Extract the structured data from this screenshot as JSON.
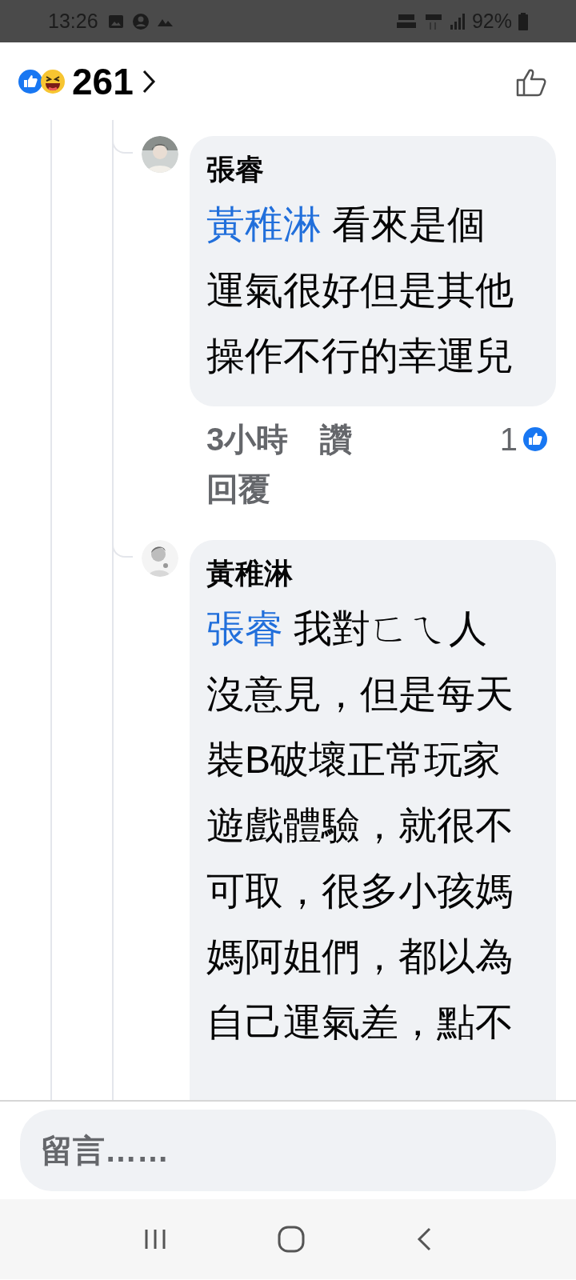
{
  "status_bar": {
    "time": "13:26",
    "battery": "92%"
  },
  "header": {
    "reaction_count": "261"
  },
  "comments": [
    {
      "author": "張睿",
      "mention": "黃稚淋",
      "text": "看來是個運氣很好但是其他操作不行的幸運兒",
      "time": "3小時",
      "like": "讚",
      "reply": "回覆",
      "like_count": "1"
    },
    {
      "author": "黃稚淋",
      "mention": "張睿",
      "text": "我對ㄈㄟ人沒意見，但是每天裝B破壞正常玩家遊戲體驗，就很不可取，很多小孩媽媽阿姐們，都以為自己運氣差，點不"
    }
  ],
  "composer": {
    "placeholder": "留言……"
  }
}
